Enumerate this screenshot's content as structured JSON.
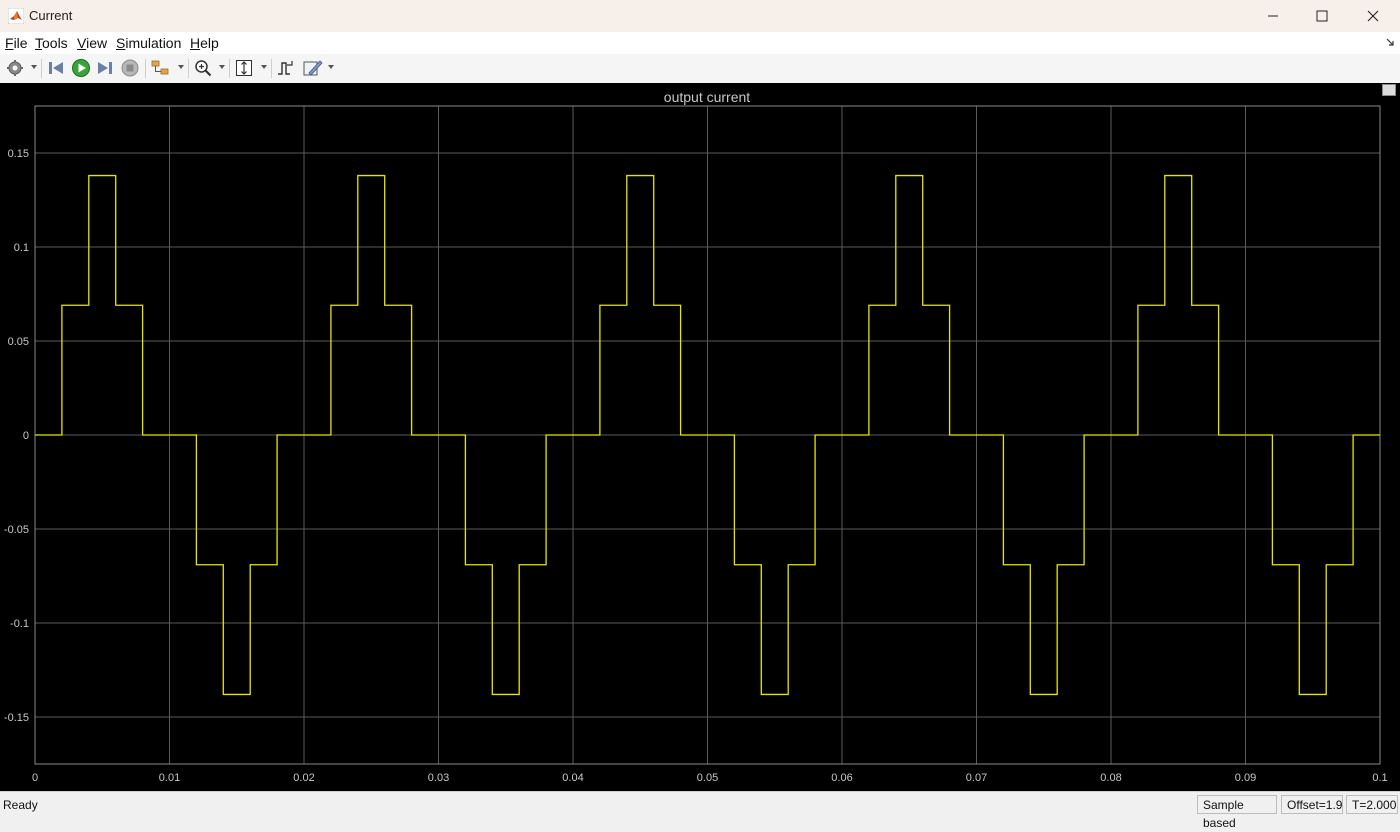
{
  "window": {
    "title": "Current"
  },
  "menu": {
    "items": [
      {
        "label": "File"
      },
      {
        "label": "Tools"
      },
      {
        "label": "View"
      },
      {
        "label": "Simulation"
      },
      {
        "label": "Help"
      }
    ]
  },
  "toolbar": {
    "icons": [
      "settings-icon",
      "step-back-icon",
      "run-icon",
      "step-forward-icon",
      "stop-icon",
      "highlight-block-icon",
      "zoom-icon",
      "scale-axes-icon",
      "triggers-icon",
      "measurements-icon"
    ]
  },
  "status": {
    "ready": "Ready",
    "sample_mode": "Sample based",
    "offset": "Offset=1.9",
    "time": "T=2.000"
  },
  "colors": {
    "trace": "#e6e600",
    "grid": "#5a5a5a",
    "background": "#000000"
  },
  "chart_data": {
    "type": "line",
    "title": "output current",
    "xlabel": "",
    "ylabel": "",
    "xlim": [
      0,
      0.1
    ],
    "ylim": [
      -0.175,
      0.175
    ],
    "grid": true,
    "x_ticks": [
      0,
      0.01,
      0.02,
      0.03,
      0.04,
      0.05,
      0.06,
      0.07,
      0.08,
      0.09,
      0.1
    ],
    "x_tick_labels": [
      "0",
      "0.01",
      "0.02",
      "0.03",
      "0.04",
      "0.05",
      "0.06",
      "0.07",
      "0.08",
      "0.09",
      "0.1"
    ],
    "y_ticks": [
      0.15,
      0.1,
      0.05,
      0,
      -0.05,
      -0.1,
      -0.15
    ],
    "y_tick_labels": [
      "0.15",
      "0.1",
      "0.05",
      "0",
      "-0.05",
      "-0.1",
      "-0.15"
    ],
    "series": [
      {
        "step": true,
        "x": [
          0,
          0.002,
          0.004,
          0.006,
          0.008,
          0.012,
          0.014,
          0.016,
          0.018,
          0.022,
          0.024,
          0.026,
          0.028,
          0.032,
          0.034,
          0.036,
          0.038,
          0.042,
          0.044,
          0.046,
          0.048,
          0.052,
          0.054,
          0.056,
          0.058,
          0.062,
          0.064,
          0.066,
          0.068,
          0.072,
          0.074,
          0.076,
          0.078,
          0.082,
          0.084,
          0.086,
          0.088,
          0.092,
          0.094,
          0.096,
          0.098,
          0.1
        ],
        "y": [
          0,
          0.069,
          0.138,
          0.069,
          0,
          -0.069,
          -0.138,
          -0.069,
          0,
          0.069,
          0.138,
          0.069,
          0,
          -0.069,
          -0.138,
          -0.069,
          0,
          0.069,
          0.138,
          0.069,
          0,
          -0.069,
          -0.138,
          -0.069,
          0,
          0.069,
          0.138,
          0.069,
          0,
          -0.069,
          -0.138,
          -0.069,
          0,
          0.069,
          0.138,
          0.069,
          0,
          -0.069,
          -0.138,
          -0.069,
          0,
          0
        ]
      }
    ]
  }
}
